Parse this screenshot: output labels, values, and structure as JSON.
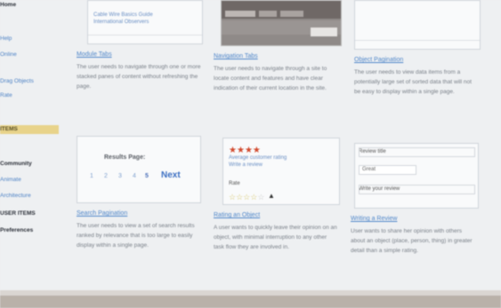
{
  "sidebar": {
    "items": [
      {
        "label": "Home",
        "style": "bold"
      },
      {
        "label": "Help",
        "style": "link"
      },
      {
        "label": "Online",
        "style": "link"
      },
      {
        "label": "Drag Objects",
        "style": "link"
      },
      {
        "label": "Rate",
        "style": "link"
      },
      {
        "label": "ITEMS",
        "style": "highlight"
      },
      {
        "label": "Community",
        "style": "bold"
      },
      {
        "label": "Animate",
        "style": "link"
      },
      {
        "label": "Architecture",
        "style": "link"
      },
      {
        "label": "USER ITEMS",
        "style": "bold"
      },
      {
        "label": "Preferences",
        "style": "bold"
      }
    ]
  },
  "cards": {
    "module_tabs": {
      "title": "Module Tabs",
      "desc": "The user needs to navigate through one or more stacked panes of content without refreshing the page.",
      "thumb_links": [
        "Cable Wire Basics Guide",
        "International Observers"
      ]
    },
    "navigation_tabs": {
      "title": "Navigation Tabs",
      "desc": "The user needs to navigate through a site to locate content and features and have clear indication of their current location in the site."
    },
    "object_pagination": {
      "title": "Object Pagination",
      "desc": "The user needs to view data items from a potentially large set of sorted data that will not be easy to display within a single page."
    },
    "search_pagination": {
      "title": "Search Pagination",
      "desc": "The user needs to view a set of search results ranked by relevance that is too large to easily display within a single page.",
      "results_label": "Results Page:",
      "page_numbers": [
        "1",
        "2",
        "3",
        "4",
        "5"
      ],
      "next_label": "Next"
    },
    "rating_object": {
      "title": "Rating an Object",
      "desc": "A user wants to quickly leave their opinion on an object, with minimal interruption to any other task flow they are involved in.",
      "links": [
        "Average customer rating",
        "Write a review"
      ],
      "rate_label": "Rate",
      "stars_filled": 4,
      "stars_total": 5
    },
    "writing_review": {
      "title": "Writing a Review",
      "desc": "User wants to share her opinion with others about an object (place, person, thing) in greater detail than a simple rating.",
      "field1_label": "Review title",
      "field1_value": "Great",
      "field2_label": "Write your review"
    }
  },
  "colors": {
    "link": "#4f86c9",
    "star": "#d24b2f",
    "highlight": "#e8d38a"
  }
}
